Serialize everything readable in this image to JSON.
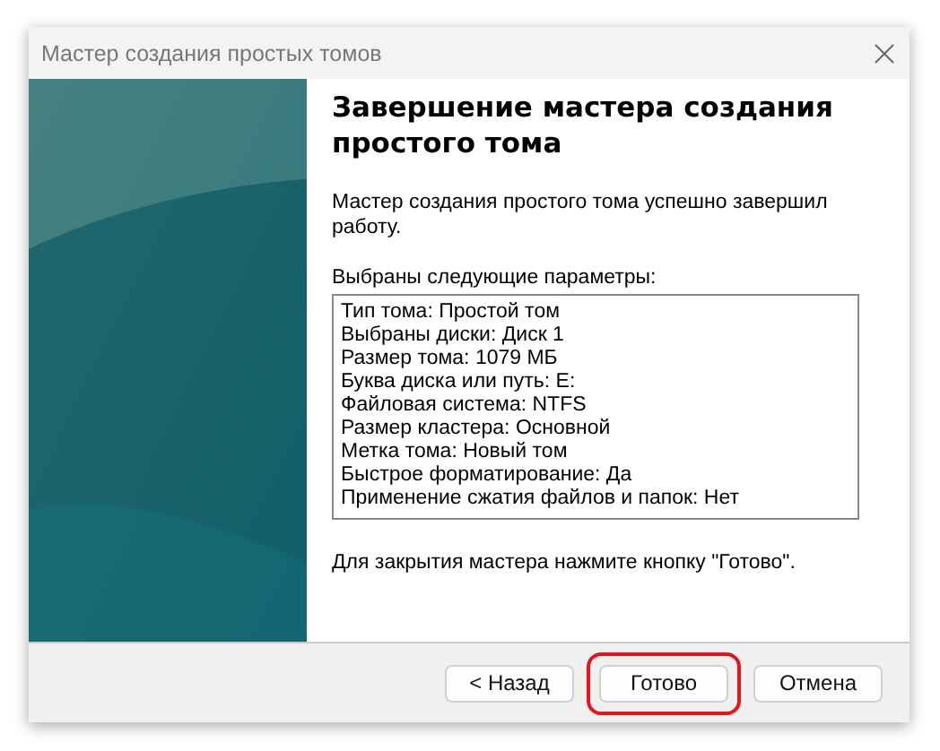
{
  "window": {
    "title": "Мастер создания простых томов"
  },
  "heading": "Завершение мастера создания простого тома",
  "message": "Мастер создания простого тома успешно завершил работу.",
  "params_label": "Выбраны следующие параметры:",
  "params": [
    "Тип тома: Простой том",
    "Выбраны диски: Диск 1",
    "Размер тома: 1079 МБ",
    "Буква диска или путь: E:",
    "Файловая система: NTFS",
    "Размер кластера: Основной",
    "Метка тома: Новый том",
    "Быстрое форматирование: Да",
    "Применение сжатия файлов и папок: Нет"
  ],
  "footer_note": "Для закрытия мастера нажмите кнопку \"Готово\".",
  "buttons": [
    {
      "label": "< Назад",
      "highlighted": false
    },
    {
      "label": "Готово",
      "highlighted": true
    },
    {
      "label": "Отмена",
      "highlighted": false
    }
  ]
}
